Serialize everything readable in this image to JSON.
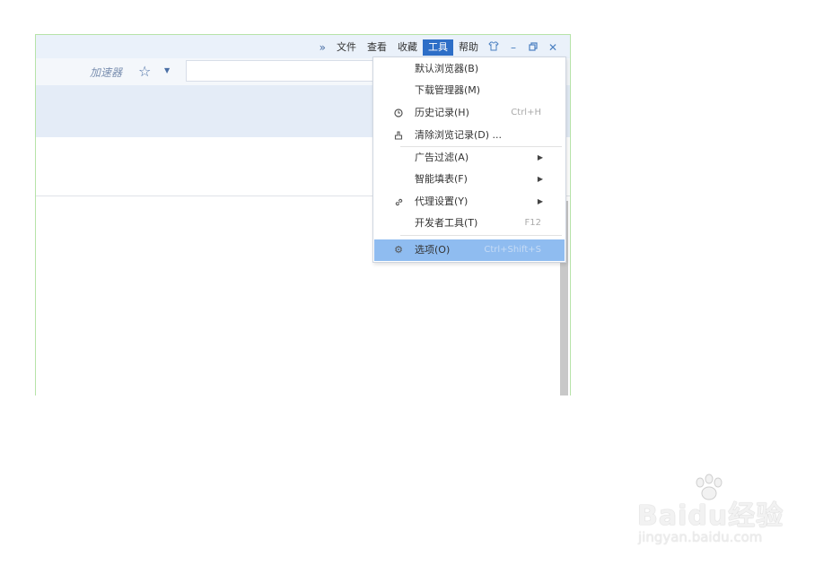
{
  "menubar": {
    "more_icon": "double-chevron-right",
    "items": [
      "文件",
      "查看",
      "收藏",
      "工具",
      "帮助"
    ],
    "active_item": "工具",
    "window_buttons": [
      "skin-icon",
      "minimize-icon",
      "restore-icon",
      "close-icon"
    ]
  },
  "addressbar": {
    "accelerator_label": "加速器",
    "favorite_icon": "star-icon"
  },
  "tools_menu": {
    "items": [
      {
        "icon": "",
        "label": "默认浏览器(B)",
        "shortcut": "",
        "submenu": false
      },
      {
        "icon": "",
        "label": "下载管理器(M)",
        "shortcut": "",
        "submenu": false
      },
      {
        "icon": "clock-icon",
        "label": "历史记录(H)",
        "shortcut": "Ctrl+H",
        "submenu": false
      },
      {
        "icon": "broom-icon",
        "label": "清除浏览记录(D) ...",
        "shortcut": "",
        "submenu": false
      },
      {
        "icon": "",
        "label": "广告过滤(A)",
        "shortcut": "",
        "submenu": true
      },
      {
        "icon": "",
        "label": "智能填表(F)",
        "shortcut": "",
        "submenu": true
      },
      {
        "icon": "link-icon",
        "label": "代理设置(Y)",
        "shortcut": "",
        "submenu": true
      },
      {
        "icon": "",
        "label": "开发者工具(T)",
        "shortcut": "F12",
        "submenu": false
      },
      {
        "icon": "gear-icon",
        "label": "选项(O)",
        "shortcut": "Ctrl+Shift+S",
        "submenu": false
      }
    ],
    "selected_item": "选项(O)"
  },
  "watermark": {
    "brand": "Baidu经验",
    "url": "jingyan.baidu.com"
  },
  "colors": {
    "highlight": "#8fbcf0",
    "active_menu": "#2d6ec7",
    "window_border": "#b6e3a8"
  }
}
